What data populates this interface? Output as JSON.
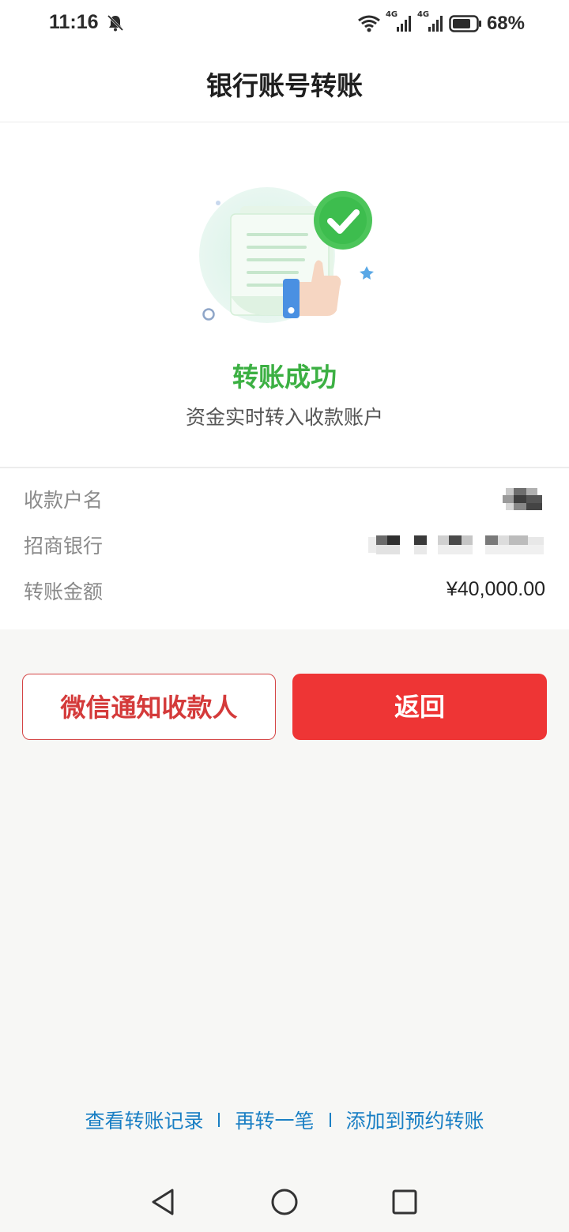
{
  "status_bar": {
    "time": "11:16",
    "battery": "68%",
    "network_1": "4G",
    "network_2": "4G",
    "icons": [
      "bell-off-icon",
      "wifi-icon",
      "signal-icon",
      "signal-icon",
      "battery-icon"
    ]
  },
  "header": {
    "title": "银行账号转账"
  },
  "result": {
    "title": "转账成功",
    "subtitle": "资金实时转入收款账户",
    "icon": "success-check-icon",
    "accent_color": "#3cb043"
  },
  "details": {
    "rows": [
      {
        "label": "收款户名",
        "value": "",
        "masked": true
      },
      {
        "label": "招商银行",
        "value": "",
        "masked": true
      },
      {
        "label": "转账金额",
        "value": "¥40,000.00",
        "masked": false
      }
    ]
  },
  "actions": {
    "notify_label": "微信通知收款人",
    "return_label": "返回",
    "primary_color": "#ee3535"
  },
  "links": {
    "history": "查看转账记录",
    "again": "再转一笔",
    "schedule": "添加到预约转账",
    "color": "#1a7fc4"
  },
  "nav_bar": {
    "icons": [
      "back-triangle-icon",
      "home-circle-icon",
      "recents-square-icon"
    ]
  }
}
